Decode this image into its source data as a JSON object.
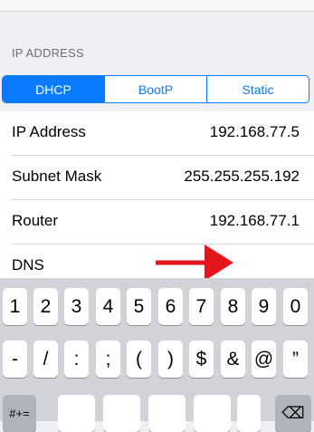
{
  "section": {
    "header": "IP ADDRESS"
  },
  "segments": [
    {
      "label": "DHCP",
      "active": true
    },
    {
      "label": "BootP",
      "active": false
    },
    {
      "label": "Static",
      "active": false
    }
  ],
  "rows": [
    {
      "label": "IP Address",
      "value": "192.168.77.5"
    },
    {
      "label": "Subnet Mask",
      "value": "255.255.255.192"
    },
    {
      "label": "Router",
      "value": "192.168.77.1"
    },
    {
      "label": "DNS",
      "value": ""
    }
  ],
  "keyboard": {
    "row1": [
      "1",
      "2",
      "3",
      "4",
      "5",
      "6",
      "7",
      "8",
      "9",
      "0"
    ],
    "row2": [
      "-",
      "/",
      ":",
      ";",
      "(",
      ")",
      "$",
      "&",
      "@",
      "”"
    ],
    "row3_left": "#+=",
    "row3_right": "⌫"
  },
  "colors": {
    "accent": "#0a7aff",
    "arrow": "#e3161b"
  }
}
